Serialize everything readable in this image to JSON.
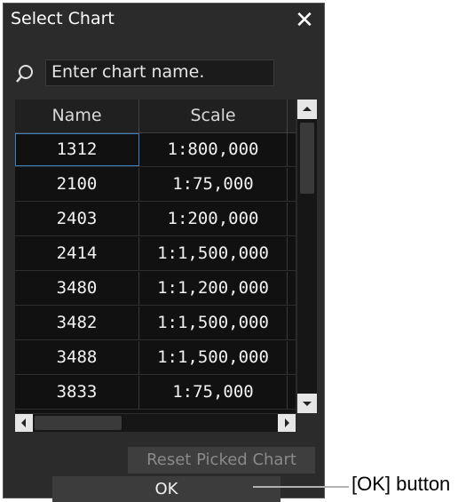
{
  "dialog": {
    "title": "Select Chart",
    "close_label": "✕"
  },
  "search": {
    "placeholder": "Enter chart name.",
    "icon": "search-icon"
  },
  "table": {
    "columns": [
      "Name",
      "Scale"
    ],
    "rows": [
      {
        "name": "1312",
        "scale": "1:800,000",
        "selected": true
      },
      {
        "name": "2100",
        "scale": "1:75,000"
      },
      {
        "name": "2403",
        "scale": "1:200,000"
      },
      {
        "name": "2414",
        "scale": "1:1,500,000"
      },
      {
        "name": "3480",
        "scale": "1:1,200,000"
      },
      {
        "name": "3482",
        "scale": "1:1,500,000"
      },
      {
        "name": "3488",
        "scale": "1:1,500,000"
      },
      {
        "name": "3833",
        "scale": "1:75,000"
      }
    ]
  },
  "buttons": {
    "reset_label": "Reset Picked Chart",
    "ok_label": "OK"
  },
  "annotation": {
    "label": "[OK] button"
  },
  "colors": {
    "dialog_bg": "#2b2b2b",
    "selection_border": "#3a7fc2"
  }
}
